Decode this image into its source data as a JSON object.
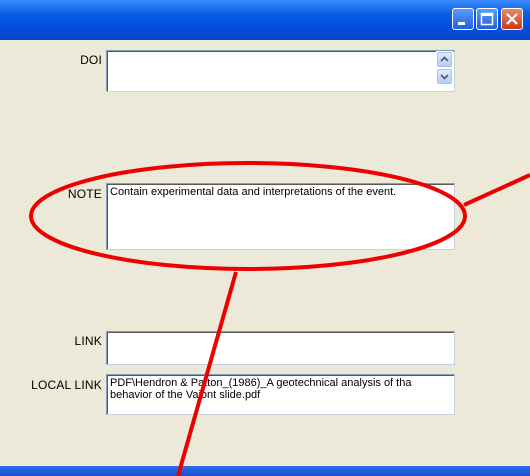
{
  "window": {
    "controls": {
      "minimize_icon": "minimize-icon",
      "maximize_icon": "maximize-icon",
      "close_icon": "close-icon"
    }
  },
  "form": {
    "doi": {
      "label": "DOI",
      "value": ""
    },
    "note": {
      "label": "NOTE",
      "value": "Contain experimental data and interpretations of the event."
    },
    "link": {
      "label": "LINK",
      "value": ""
    },
    "local_link": {
      "label": "LOCAL LINK",
      "value": "PDF\\Hendron & Patton_(1986)_A geotechnical analysis of tha behavior of the Vaiont slide.pdf"
    }
  },
  "annotation": {
    "color": "#ee0000"
  },
  "theme": {
    "window_bg": "#ece9d8",
    "titlebar_blue": "#0a5fe0",
    "close_red": "#c83a17"
  }
}
